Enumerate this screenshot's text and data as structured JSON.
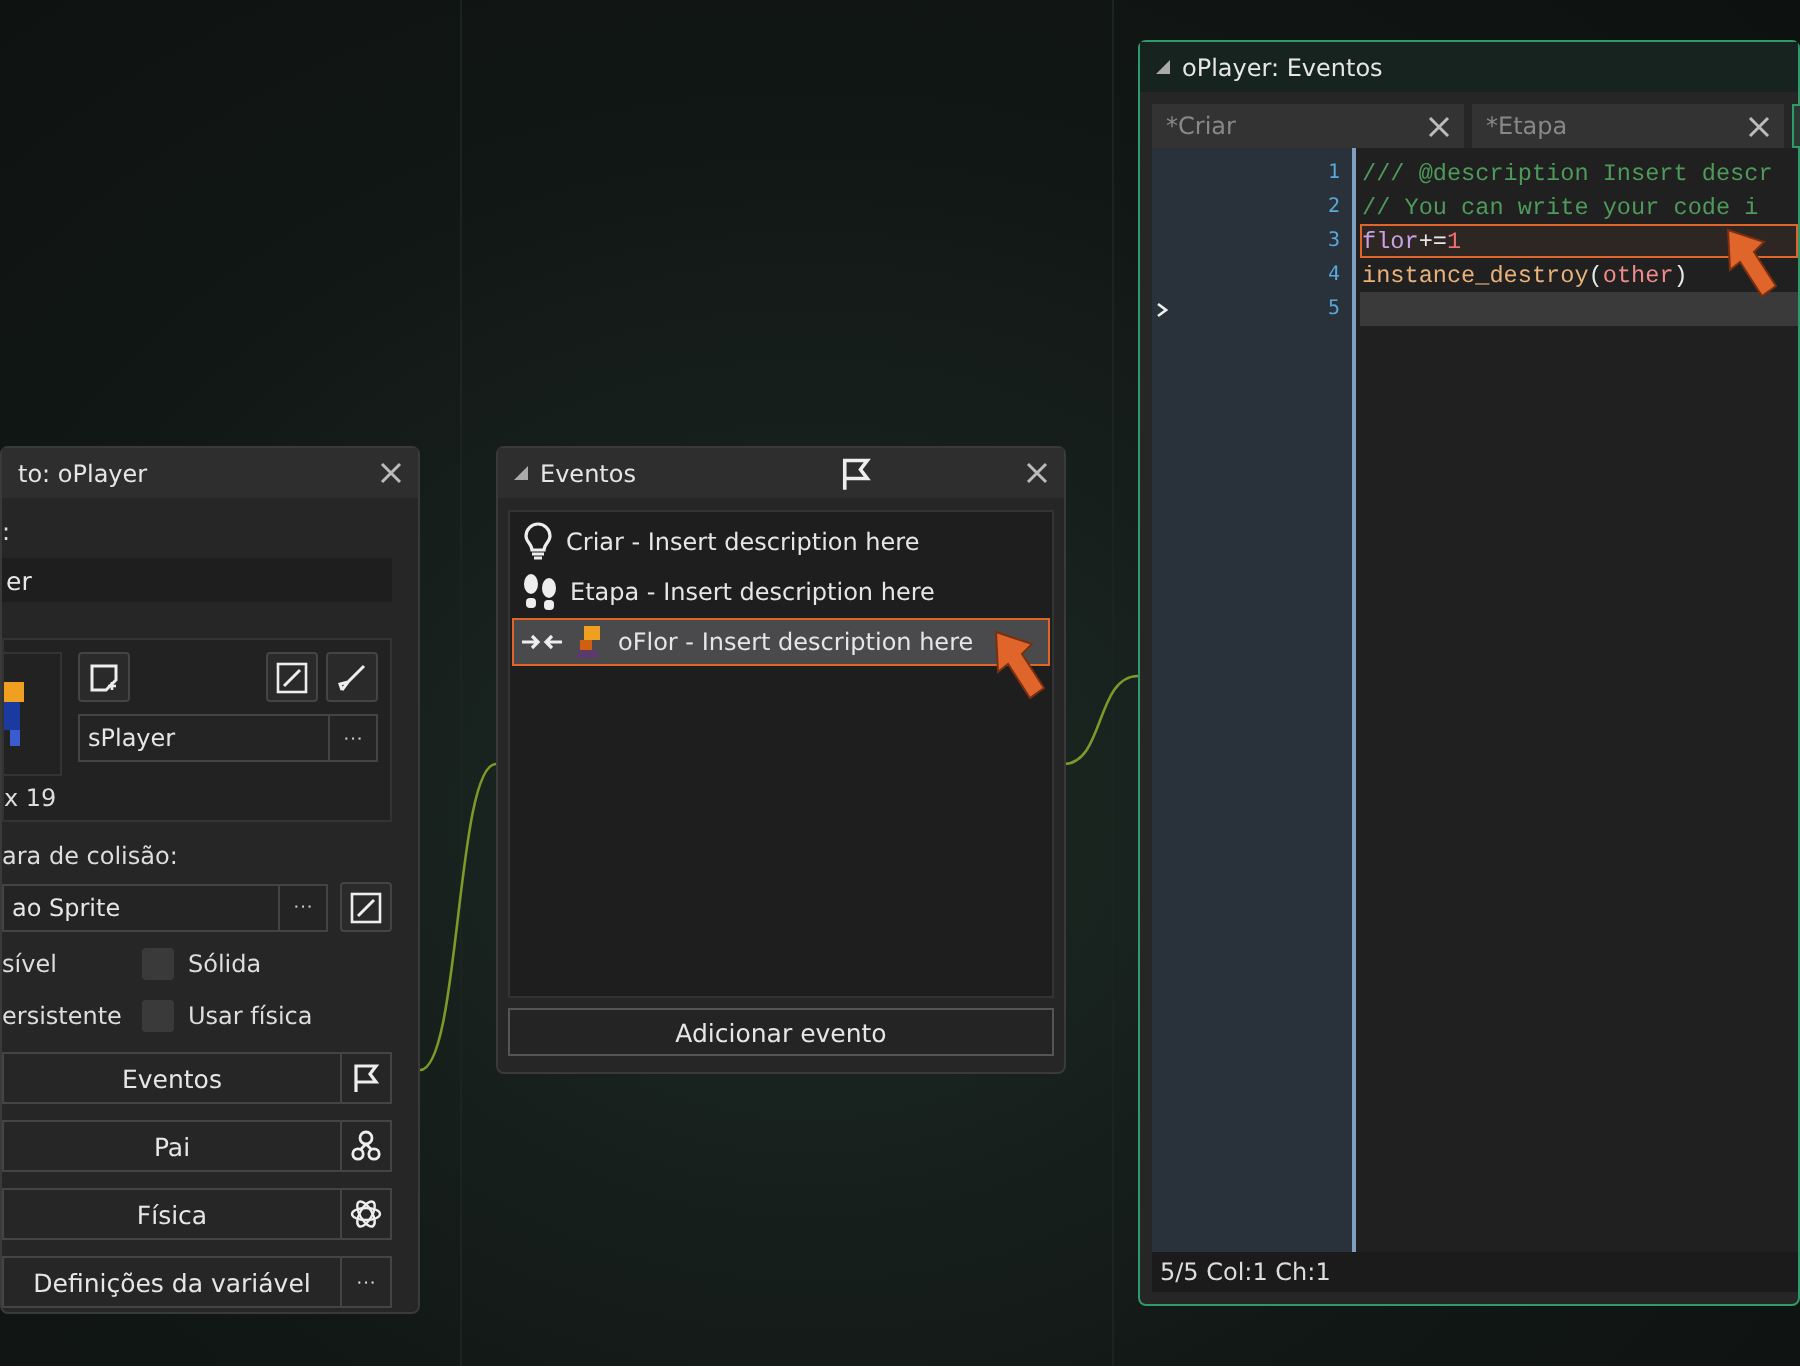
{
  "object_panel": {
    "title": "to: oPlayer",
    "name_label": ":",
    "name_value": "er",
    "sprite_name": "sPlayer",
    "sprite_menu": "···",
    "sprite_size": "x 19",
    "collision_label": "ara de colisão:",
    "collision_value": "ao Sprite",
    "collision_menu": "···",
    "options": [
      {
        "label": "sível"
      },
      {
        "label": "Sólida",
        "checked": false
      },
      {
        "label": "ersistente"
      },
      {
        "label": "Usar física",
        "checked": false
      }
    ],
    "buttons": [
      {
        "label": "Eventos",
        "kind": "flag"
      },
      {
        "label": "Pai",
        "kind": "parent"
      },
      {
        "label": "Física",
        "kind": "atom"
      },
      {
        "label": "Definições da variável",
        "kind": "dots",
        "symbol": "···"
      }
    ]
  },
  "events_panel": {
    "title": "Eventos",
    "events": [
      {
        "kind": "create",
        "label": "Criar - Insert description here",
        "selected": false
      },
      {
        "kind": "step",
        "label": "Etapa - Insert description here",
        "selected": false
      },
      {
        "kind": "collision",
        "label": "oFlor - Insert description here",
        "selected": true
      }
    ],
    "add_button": "Adicionar evento"
  },
  "code_window": {
    "title": "oPlayer: Eventos",
    "tabs": [
      {
        "label": "*Criar",
        "selected": false
      },
      {
        "label": "*Etapa",
        "selected": false
      },
      {
        "selected": true
      }
    ],
    "lines": [
      {
        "number": "1",
        "highlighted": false,
        "current": false,
        "tokens": [
          {
            "kind": "comment",
            "text": "/// @description Insert descr"
          }
        ]
      },
      {
        "number": "2",
        "highlighted": false,
        "current": false,
        "tokens": [
          {
            "kind": "comment",
            "text": "// You can write your code i"
          }
        ]
      },
      {
        "number": "3",
        "highlighted": true,
        "current": false,
        "tokens": [
          {
            "kind": "variable",
            "text": "flor"
          },
          {
            "kind": "operator",
            "text": "+="
          },
          {
            "kind": "number",
            "text": "1"
          }
        ]
      },
      {
        "number": "4",
        "highlighted": false,
        "current": false,
        "tokens": [
          {
            "kind": "function",
            "text": "instance_destroy"
          },
          {
            "kind": "operator",
            "text": "("
          },
          {
            "kind": "keyword",
            "text": "other"
          },
          {
            "kind": "operator",
            "text": ")"
          }
        ]
      },
      {
        "number": "5",
        "highlighted": false,
        "current": true
      }
    ],
    "status": "5/5 Col:1 Ch:1"
  }
}
